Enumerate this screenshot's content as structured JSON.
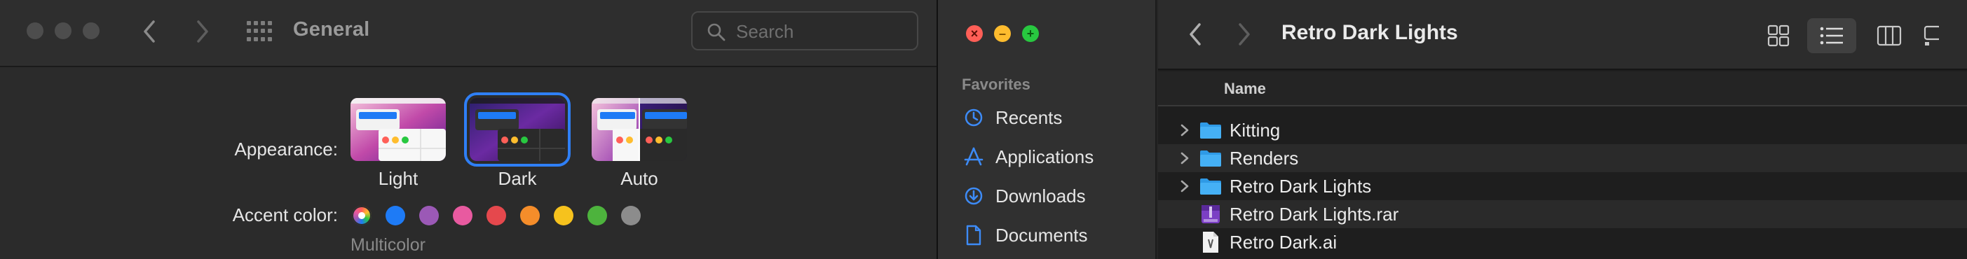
{
  "prefs": {
    "title": "General",
    "search": {
      "placeholder": "Search"
    },
    "appearance_label": "Appearance:",
    "themes": [
      {
        "label": "Light",
        "selected": false
      },
      {
        "label": "Dark",
        "selected": true
      },
      {
        "label": "Auto",
        "selected": false
      }
    ],
    "accent_label": "Accent color:",
    "accent_colors": [
      "multicolor",
      "#1e7bf6",
      "#9b59b6",
      "#e85aa0",
      "#e5484d",
      "#f58d2a",
      "#f6c21d",
      "#4db33d",
      "#8c8c8c"
    ],
    "accent_selected_label": "Multicolor"
  },
  "finder": {
    "title": "Retro Dark Lights",
    "sidebar": {
      "section": "Favorites",
      "items": [
        {
          "label": "Recents",
          "icon": "clock-icon"
        },
        {
          "label": "Applications",
          "icon": "applications-icon"
        },
        {
          "label": "Downloads",
          "icon": "download-icon"
        },
        {
          "label": "Documents",
          "icon": "document-icon"
        }
      ]
    },
    "column_header": "Name",
    "files": [
      {
        "name": "Kitting",
        "type": "folder"
      },
      {
        "name": "Renders",
        "type": "folder"
      },
      {
        "name": "Retro Dark Lights",
        "type": "folder"
      },
      {
        "name": "Retro Dark Lights.rar",
        "type": "rar"
      },
      {
        "name": "Retro Dark.ai",
        "type": "ai"
      }
    ]
  }
}
